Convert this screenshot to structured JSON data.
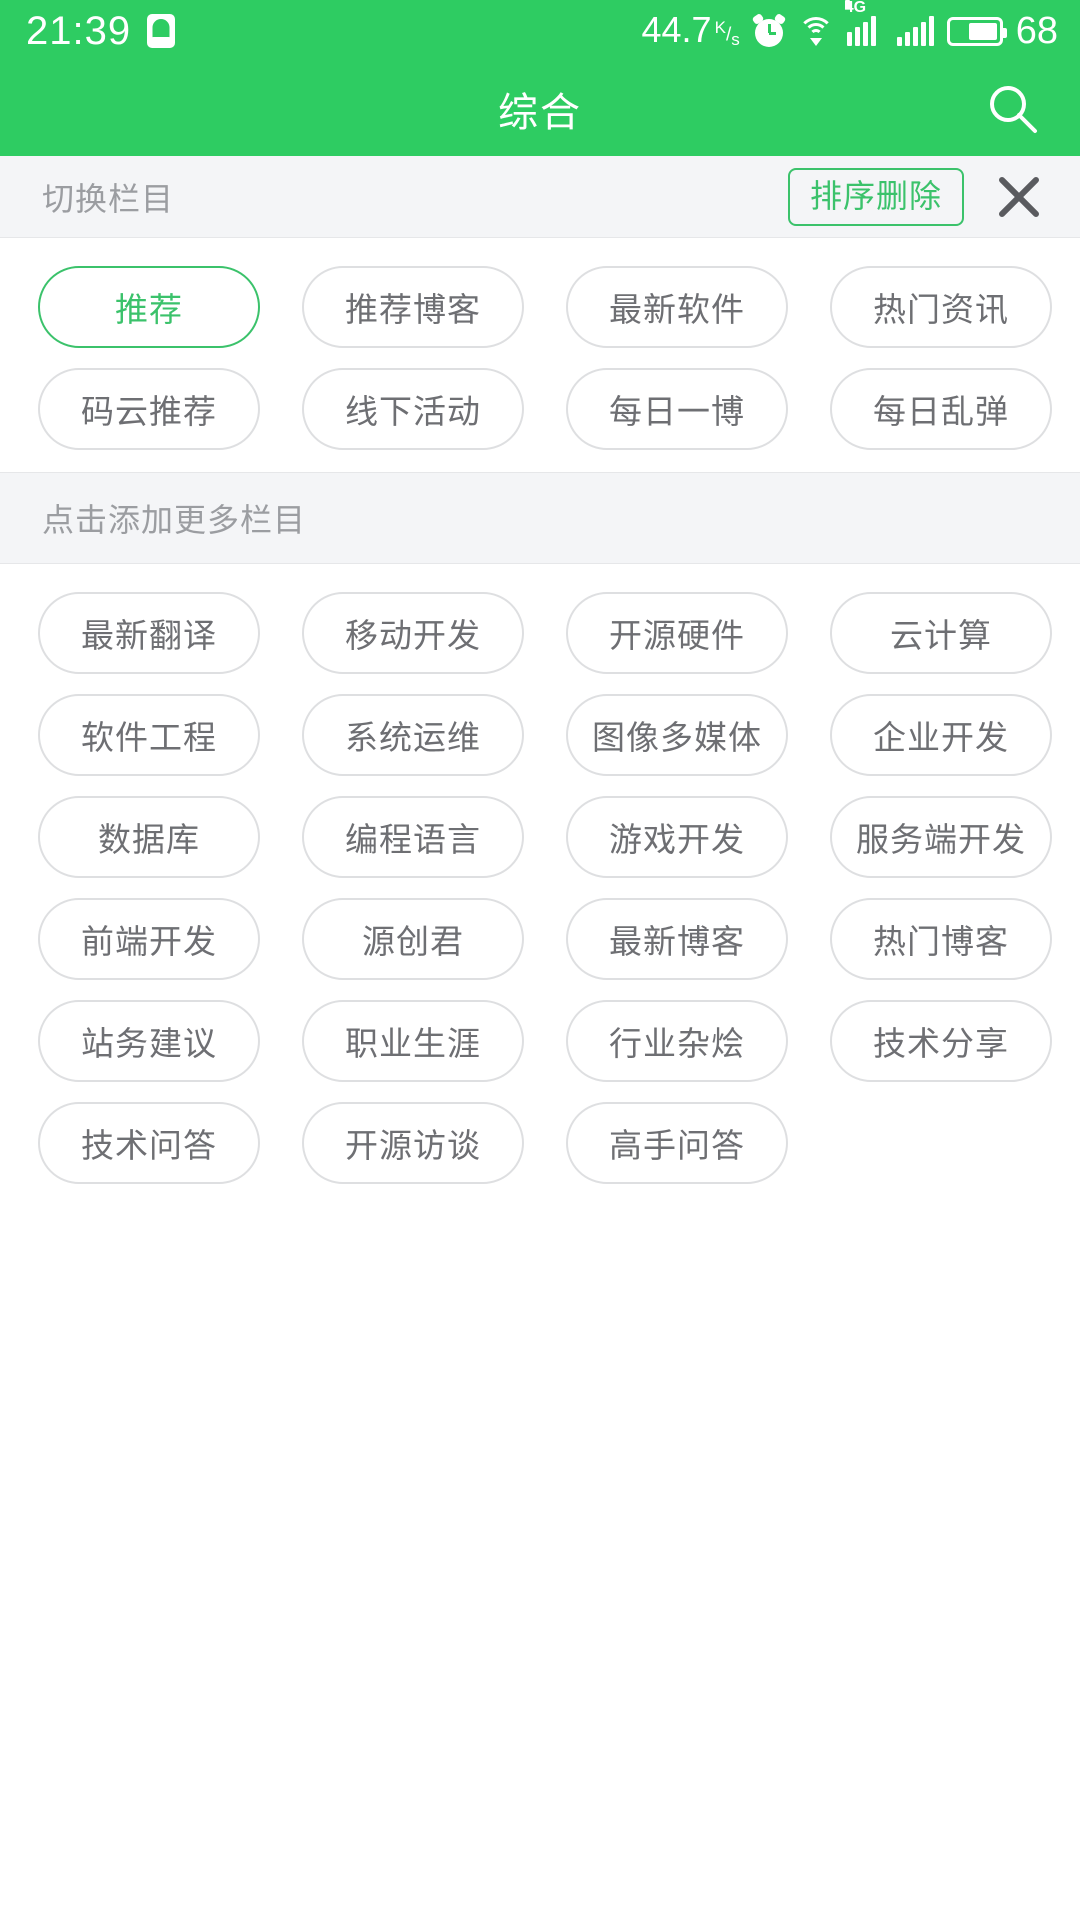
{
  "status_bar": {
    "time": "21:39",
    "notification_icon": "qq-icon",
    "network_speed": "44.7",
    "speed_unit_k": "K",
    "speed_unit_slash": "/",
    "speed_unit_s": "s",
    "alarm_icon": "alarm-clock-icon",
    "wifi_icon": "wifi-icon",
    "network_type": "4G",
    "signal_icon_1": "signal-bars-icon",
    "signal_icon_2": "signal-bars-icon",
    "battery_icon": "battery-icon",
    "battery_level": "68"
  },
  "app_bar": {
    "title": "综合",
    "search_icon": "search-icon"
  },
  "sub_header": {
    "title": "切换栏目",
    "sort_delete_label": "排序删除",
    "close_icon": "close-icon"
  },
  "my_channels": {
    "items": [
      {
        "label": "推荐",
        "selected": true
      },
      {
        "label": "推荐博客",
        "selected": false
      },
      {
        "label": "最新软件",
        "selected": false
      },
      {
        "label": "热门资讯",
        "selected": false
      },
      {
        "label": "码云推荐",
        "selected": false
      },
      {
        "label": "线下活动",
        "selected": false
      },
      {
        "label": "每日一博",
        "selected": false
      },
      {
        "label": "每日乱弹",
        "selected": false
      }
    ]
  },
  "more_channels": {
    "section_title": "点击添加更多栏目",
    "items": [
      {
        "label": "最新翻译"
      },
      {
        "label": "移动开发"
      },
      {
        "label": "开源硬件"
      },
      {
        "label": "云计算"
      },
      {
        "label": "软件工程"
      },
      {
        "label": "系统运维"
      },
      {
        "label": "图像多媒体"
      },
      {
        "label": "企业开发"
      },
      {
        "label": "数据库"
      },
      {
        "label": "编程语言"
      },
      {
        "label": "游戏开发"
      },
      {
        "label": "服务端开发"
      },
      {
        "label": "前端开发"
      },
      {
        "label": "源创君"
      },
      {
        "label": "最新博客"
      },
      {
        "label": "热门博客"
      },
      {
        "label": "站务建议"
      },
      {
        "label": "职业生涯"
      },
      {
        "label": "行业杂烩"
      },
      {
        "label": "技术分享"
      },
      {
        "label": "技术问答"
      },
      {
        "label": "开源访谈"
      },
      {
        "label": "高手问答"
      }
    ]
  },
  "colors": {
    "brand_green": "#2ECC62",
    "accent_green": "#3BC26B",
    "band_bg": "#F4F5F7",
    "chip_border": "#DEDFE1",
    "chip_text": "#6E6F73",
    "muted_text": "#9B9DA1"
  }
}
